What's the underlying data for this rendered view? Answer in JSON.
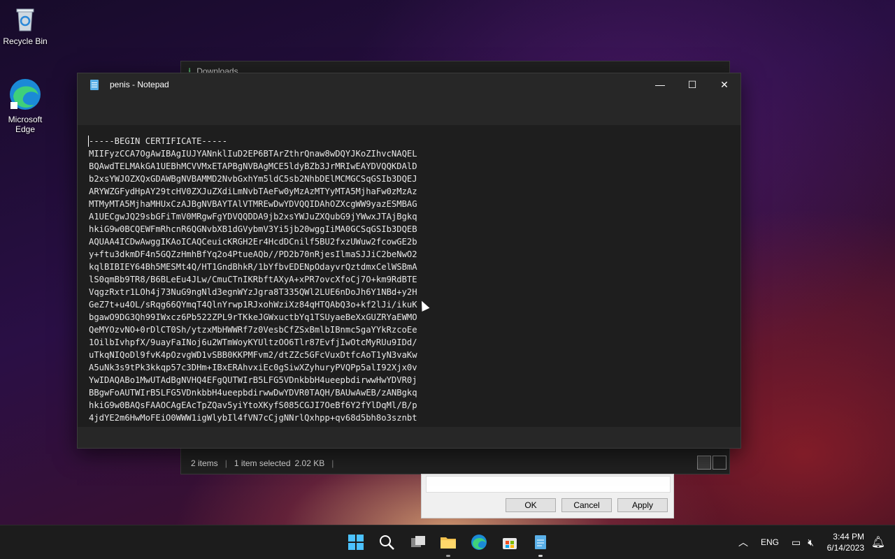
{
  "desktop": {
    "icons": [
      {
        "label": "Recycle Bin",
        "icon": "recycle-bin-icon"
      },
      {
        "label": "Microsoft Edge",
        "icon": "edge-icon"
      }
    ]
  },
  "explorer": {
    "title": "Downloads",
    "status": {
      "items": "2 items",
      "selected": "1 item selected",
      "size": "2.02 KB"
    }
  },
  "properties_dialog": {
    "ok": "OK",
    "cancel": "Cancel",
    "apply": "Apply"
  },
  "notepad": {
    "title": "penis - Notepad",
    "lines": [
      "-----BEGIN CERTIFICATE-----",
      "MIIFyzCCA7OgAwIBAgIUJYANnklIuD2EP6BTArZthrQnaw8wDQYJKoZIhvcNAQEL",
      "BQAwdTELMAkGA1UEBhMCVVMxETAPBgNVBAgMCE5ldyBZb3JrMRIwEAYDVQQKDAlD",
      "b2xsYWJOZXQxGDAWBgNVBAMMD2NvbGxhYm5ldC5sb2NhbDElMCMGCSqGSIb3DQEJ",
      "ARYWZGFydHpAY29tcHV0ZXJuZXdiLmNvbTAeFw0yMzAzMTYyMTA5MjhaFw0zMzAz",
      "MTMyMTA5MjhaMHUxCzAJBgNVBAYTAlVTMREwDwYDVQQIDAhOZXcgWW9yazESMBAG",
      "A1UECgwJQ29sbGFiTmV0MRgwFgYDVQQDDA9jb2xsYWJuZXQubG9jYWwxJTAjBgkq",
      "hkiG9w0BCQEWFmRhcnR6QGNvbXB1dGVybmV3Yi5jb20wggIiMA0GCSqGSIb3DQEB",
      "AQUAA4ICDwAwggIKAoICAQCeuicKRGH2Er4HcdDCnilf5BU2fxzUWuw2fcowGE2b",
      "y+ftu3dkmDF4n5GQZzHmhBfYq2o4PtueAQb//PD2b70nRjesIlmaSJJiC2beNwO2",
      "kqlBIBIEY64Bh5MESMt4Q/HT1GndBhkR/1bYfbvEDENpOdayvrQztdmxCelWSBmA",
      "lS0qmBb9TR8/B6BLeEu4JLw/CmuCTnIKRbftAXyA+xPR7ovcXfoCj7O+km9RdBTE",
      "VqgzRxtr1LOh4j73NuG9ngNld3egnWYzJgra8T335QWl2LUE6nDoJh6Y1NBd+y2H",
      "GeZ7t+u4OL/sRqg66QYmqT4QlnYrwp1RJxohWziXz84qHTQAbQ3o+kf2lJi/ikuK",
      "bgawO9DG3Qh99IWxcz6Pb522ZPL9rTKkeJGWxuctbYq1TSUyaeBeXxGUZRYaEWMO",
      "QeMYOzvNO+0rDlCT0Sh/ytzxMbHWWRf7z0VesbCfZSxBmlbIBnmc5gaYYkRzcoEe",
      "1OilbIvhpfX/9uayFaINoj6u2WTmWoyKYUltzOO6Tlr87EvfjIwOtcMyRUu9IDd/",
      "uTkqNIQoDl9fvK4pOzvgWD1vSBB0KKPMFvm2/dtZZc5GFcVuxDtfcAoT1yN3vaKw",
      "A5uNk3s9tPk3kkqp57c3DHm+IBxERAhvxiEc0gSiwXZyhuryPVQPp5alI92Xjx0v",
      "YwIDAQABo1MwUTAdBgNVHQ4EFgQUTWIrB5LFG5VDnkbbH4ueepbdirwwHwYDVR0j",
      "BBgwFoAUTWIrB5LFG5VDnkbbH4ueepbdirwwDwYDVR0TAQH/BAUwAwEB/zANBgkq",
      "hkiG9w0BAQsFAAOCAgEAcTpZQav5yiYtoXKyfS085CGJI7OeBf6Y2fYlDqMl/B/p",
      "4jdYE2m6HwMoFEiO0WWW1igWlybIl4fVN7cCjgNNrlQxhpp+qv68d5bh8o3sznbt"
    ]
  },
  "taskbar": {
    "language": "ENG",
    "time": "3:44 PM",
    "date": "6/14/2023"
  }
}
